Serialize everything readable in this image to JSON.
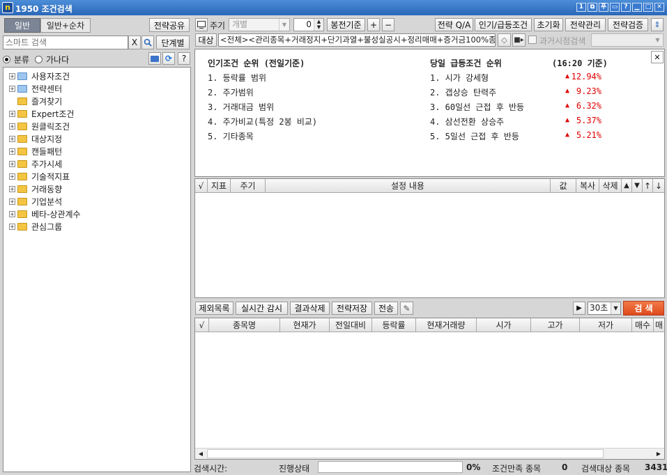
{
  "window": {
    "title": "1950 조건검색",
    "logo": "n",
    "controls": [
      "1",
      "⧉",
      "푸",
      "▭",
      "?",
      "▁",
      "□",
      "✕"
    ]
  },
  "left": {
    "tabs": [
      "일반",
      "일반+순차"
    ],
    "share_button": "전략공유",
    "search_placeholder": "스마트 검색",
    "clear_button": "X",
    "step_button": "단계별",
    "radio_sort": "분류",
    "radio_alpha": "가나다",
    "tree": [
      {
        "label": "사용자조건",
        "color": "blue"
      },
      {
        "label": "전략센터",
        "color": "blue"
      },
      {
        "label": "즐겨찾기",
        "color": "yellow"
      },
      {
        "label": "Expert조건",
        "color": "yellow"
      },
      {
        "label": "원클릭조건",
        "color": "yellow"
      },
      {
        "label": "대상지정",
        "color": "yellow"
      },
      {
        "label": "캔들패턴",
        "color": "yellow"
      },
      {
        "label": "주가시세",
        "color": "yellow"
      },
      {
        "label": "기술적지표",
        "color": "yellow"
      },
      {
        "label": "거래동향",
        "color": "yellow"
      },
      {
        "label": "기업분석",
        "color": "yellow"
      },
      {
        "label": "베타-상관계수",
        "color": "yellow"
      },
      {
        "label": "관심그룹",
        "color": "yellow"
      }
    ]
  },
  "toolbar": {
    "period_label": "주기",
    "period_value": "개별",
    "num_value": "0",
    "candle_basis": "봉전기준",
    "plus": "+",
    "minus": "−",
    "strategy_qa": "전략 Q/A",
    "popular": "인기/급등조건",
    "reset": "초기화",
    "manage": "전략관리",
    "verify": "전략검증",
    "target_label": "대상",
    "target_value": "<전체><관리종목+거래정지+단기과열+불성실공시+정리매매+증거금100%종",
    "past_search": "과거시점검색"
  },
  "popular": {
    "left_title": "인기조건 순위 (전일기준)",
    "left_items": [
      "1. 등락률 범위",
      "2. 주가범위",
      "3. 거래대금 범위",
      "4. 주가비교(특정 2봉 비교)",
      "5. 기타종목"
    ],
    "right_title": "당일 급등조건 순위",
    "right_time": "(16:20 기준)",
    "right_items": [
      {
        "name": "1. 시가 강세형",
        "rate": "12.94%"
      },
      {
        "name": "2. 갭상승 탄력주",
        "rate": "9.23%"
      },
      {
        "name": "3. 60일선 근접 후 반등",
        "rate": "6.32%"
      },
      {
        "name": "4. 삼선전환 상승주",
        "rate": "5.37%"
      },
      {
        "name": "5. 5일선 근접 후 반등",
        "rate": "5.21%"
      }
    ],
    "close": "✕"
  },
  "cond_table": {
    "headers": [
      "√",
      "지표",
      "주기",
      "설정 내용",
      "값",
      "복사",
      "삭제",
      "▲",
      "▼",
      "↑",
      "↓"
    ]
  },
  "actions": {
    "exclude": "제외목록",
    "realtime": "실시간 감시",
    "delete_result": "결과삭제",
    "save_strategy": "전략저장",
    "send": "전송",
    "interval": "30초",
    "search": "검 색"
  },
  "result_table": {
    "headers": [
      "√",
      "종목명",
      "현재가",
      "전일대비",
      "등락률",
      "현재거래량",
      "시가",
      "고가",
      "저가",
      "매수",
      "매"
    ]
  },
  "status": {
    "search_time_label": "검색시간:",
    "progress_label": "진행상태",
    "progress_pct": "0%",
    "match_label": "조건만족 종목",
    "match_count": "0",
    "target_label": "검색대상 종목",
    "target_count": "3431"
  },
  "colors": {
    "accent": "#2a67b8",
    "search_btn": "#e85a2a",
    "rate_red": "#e00000"
  }
}
